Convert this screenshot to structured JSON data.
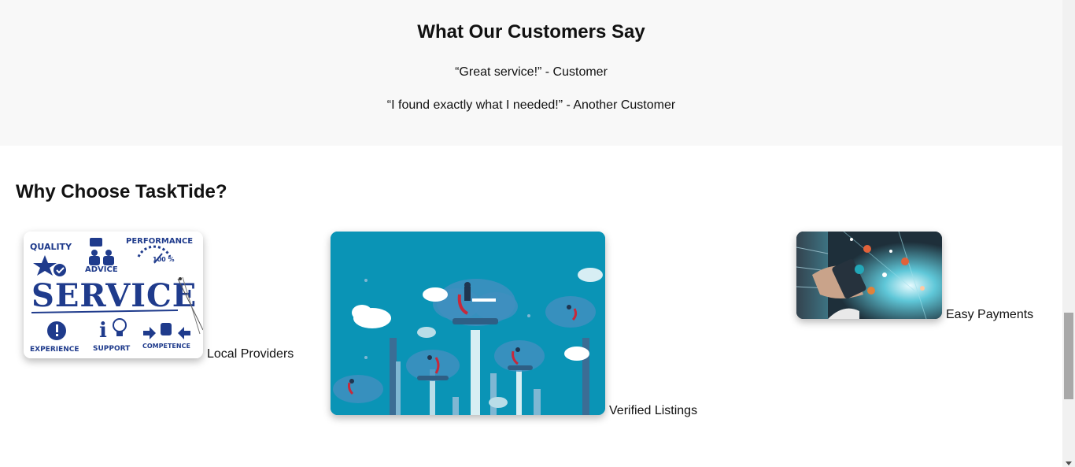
{
  "testimonials": {
    "title": "What Our Customers Say",
    "quotes": [
      "“Great service!” - Customer",
      "“I found exactly what I needed!” - Another Customer"
    ]
  },
  "why": {
    "title": "Why Choose TaskTide?",
    "features": [
      {
        "label": "Local Providers",
        "image_text": {
          "quality": "QUALITY",
          "performance": "PERFORMANCE",
          "percent": "100 %",
          "advice": "ADVICE",
          "service": "SERVICE",
          "experience": "EXPERIENCE",
          "support": "SUPPORT",
          "competence": "COMPETENCE"
        }
      },
      {
        "label": "Verified Listings"
      },
      {
        "label": "Easy Payments"
      }
    ]
  },
  "colors": {
    "section_bg": "#f8f8f8",
    "service_blue": "#1f3b8c",
    "cloud_teal": "#0a94b6",
    "warehouse_dark": "#1e2f3a"
  }
}
